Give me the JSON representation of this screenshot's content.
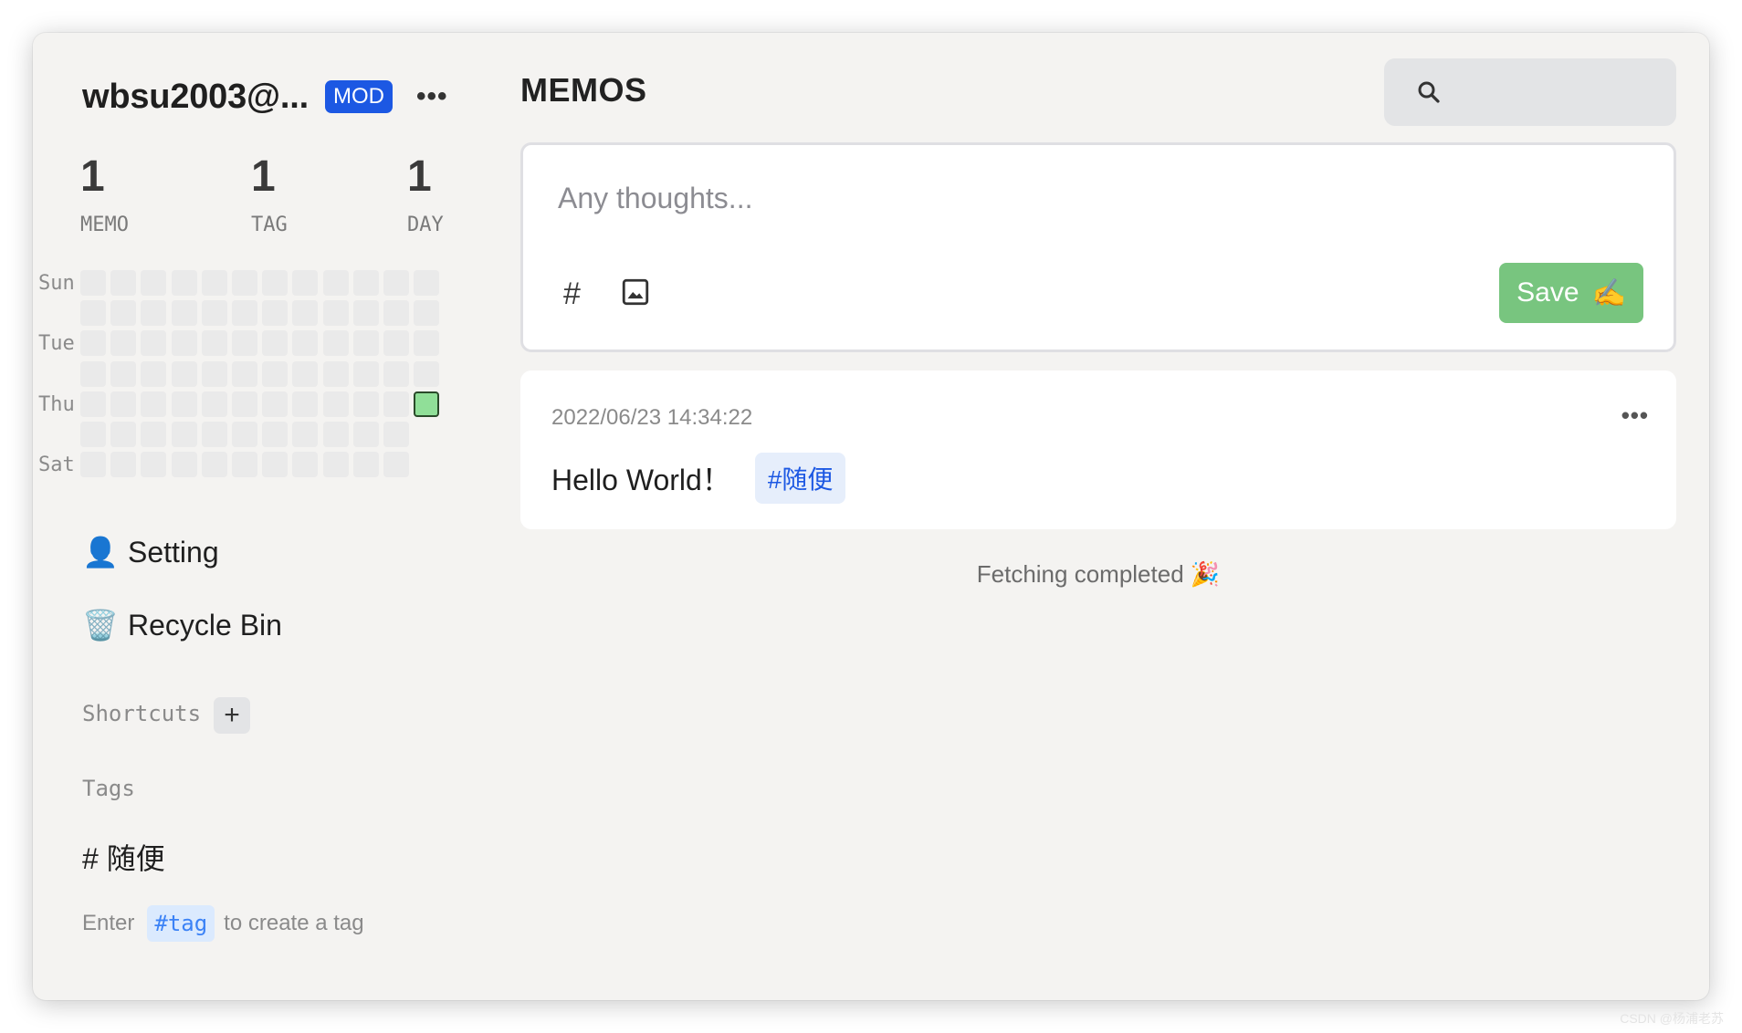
{
  "sidebar": {
    "username": "wbsu2003@...",
    "role_badge": "MOD",
    "more_icon": "more-horizontal-icon",
    "stats": [
      {
        "value": "1",
        "label": "MEMO"
      },
      {
        "value": "1",
        "label": "TAG"
      },
      {
        "value": "1",
        "label": "DAY"
      }
    ],
    "heatmap": {
      "day_labels": [
        "Sun",
        "Tue",
        "Thu",
        "Sat"
      ],
      "weeks": 12,
      "active_color": "#90df98",
      "empty_color": "#eaeaea"
    },
    "nav": [
      {
        "icon": "👤",
        "label": "Setting"
      },
      {
        "icon": "🗑️",
        "label": "Recycle Bin"
      }
    ],
    "shortcuts_title": "Shortcuts",
    "add_shortcut": "+",
    "tags_title": "Tags",
    "tags": [
      {
        "label": "# 随便"
      }
    ],
    "tag_hint": {
      "before": "Enter",
      "code": "#tag",
      "after": "to create a tag"
    }
  },
  "main": {
    "title": "MEMOS",
    "search": {
      "placeholder": "",
      "icon": "search-icon"
    },
    "editor": {
      "placeholder": "Any thoughts...",
      "hash_button": "#",
      "image_icon": "image-icon",
      "save_label": "Save",
      "save_emoji": "✍️"
    },
    "memos": [
      {
        "timestamp": "2022/06/23 14:34:22",
        "content": "Hello World！",
        "tag": "#随便"
      }
    ],
    "status": "Fetching completed 🎉"
  },
  "watermark": "CSDN @杨浦老苏",
  "colors": {
    "accent_blue": "#1c58e3",
    "save_green": "#78c57f",
    "window_bg": "#f4f3f1"
  }
}
